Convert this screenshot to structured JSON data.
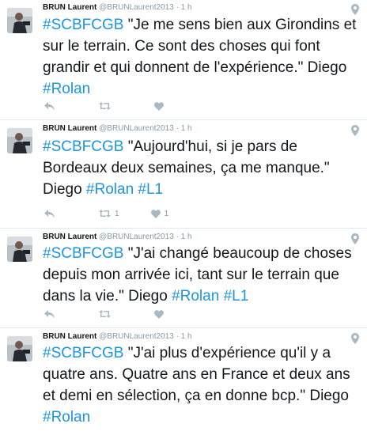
{
  "tweets": [
    {
      "name": "BRUN Laurent",
      "handle": "@BRUNLaurent2013",
      "sep": "·",
      "time": "1 h",
      "hashtag": "#SCBFCGB",
      "body": " \"Je me sens bien aux Girondins et sur le terrain. Ce sont des choses qui font grandir et qui donnent de l'expérience.\" Diego ",
      "tags_after": [
        "#Rolan"
      ],
      "retweets": "",
      "likes": ""
    },
    {
      "name": "BRUN Laurent",
      "handle": "@BRUNLaurent2013",
      "sep": "·",
      "time": "1 h",
      "hashtag": "#SCBFCGB",
      "body": " \"Aujourd'hui, si je pars de Bordeaux deux semaines, ça me manque.\" Diego ",
      "tags_after": [
        "#Rolan",
        "#L1"
      ],
      "retweets": "1",
      "likes": "1"
    },
    {
      "name": "BRUN Laurent",
      "handle": "@BRUNLaurent2013",
      "sep": "·",
      "time": "1 h",
      "hashtag": "#SCBFCGB",
      "body": " \"J'ai changé beaucoup de choses depuis mon arrivée ici, tant sur le terrain que dans la vie.\" Diego ",
      "tags_after": [
        "#Rolan",
        "#L1"
      ],
      "retweets": "",
      "likes": ""
    },
    {
      "name": "BRUN Laurent",
      "handle": "@BRUNLaurent2013",
      "sep": "·",
      "time": "1 h",
      "hashtag": "#SCBFCGB",
      "body": " \"J'ai plus d'expérience qu'il y a quatre ans. Quatre ans en France et deux ans et demi en sélection, ça en donne bcp.\" Diego ",
      "tags_after": [
        "#Rolan"
      ],
      "retweets": "",
      "likes": ""
    }
  ],
  "colors": {
    "hashtag": "#1b95e0",
    "meta": "#8899a6",
    "icon": "#aab8c2",
    "divider": "#e1e8ed"
  },
  "icons": {
    "reply": "reply-icon",
    "retweet": "retweet-icon",
    "like": "heart-icon",
    "location": "location-pin-icon"
  }
}
